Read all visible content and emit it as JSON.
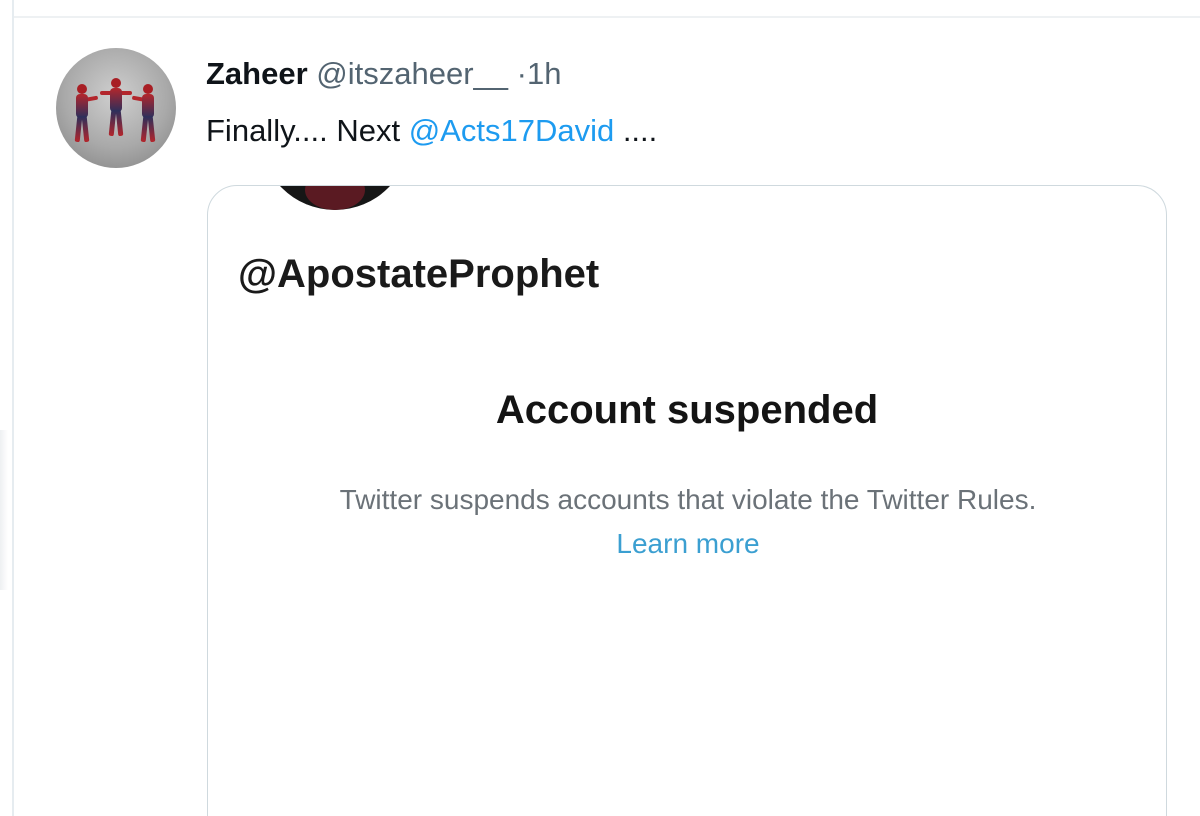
{
  "tweet": {
    "display_name": "Zaheer",
    "handle": "@itszaheer__",
    "separator": "·",
    "timestamp": "1h",
    "text_before": "Finally.... Next ",
    "mention": "@Acts17David",
    "text_after": " ...."
  },
  "embedded_card": {
    "handle": "@ApostateProphet",
    "title": "Account suspended",
    "description": "Twitter suspends accounts that violate the Twitter Rules.",
    "link_label": "Learn more"
  },
  "colors": {
    "link": "#1d9bf0",
    "secondary_text": "#536471",
    "card_border": "#cfd9de"
  }
}
